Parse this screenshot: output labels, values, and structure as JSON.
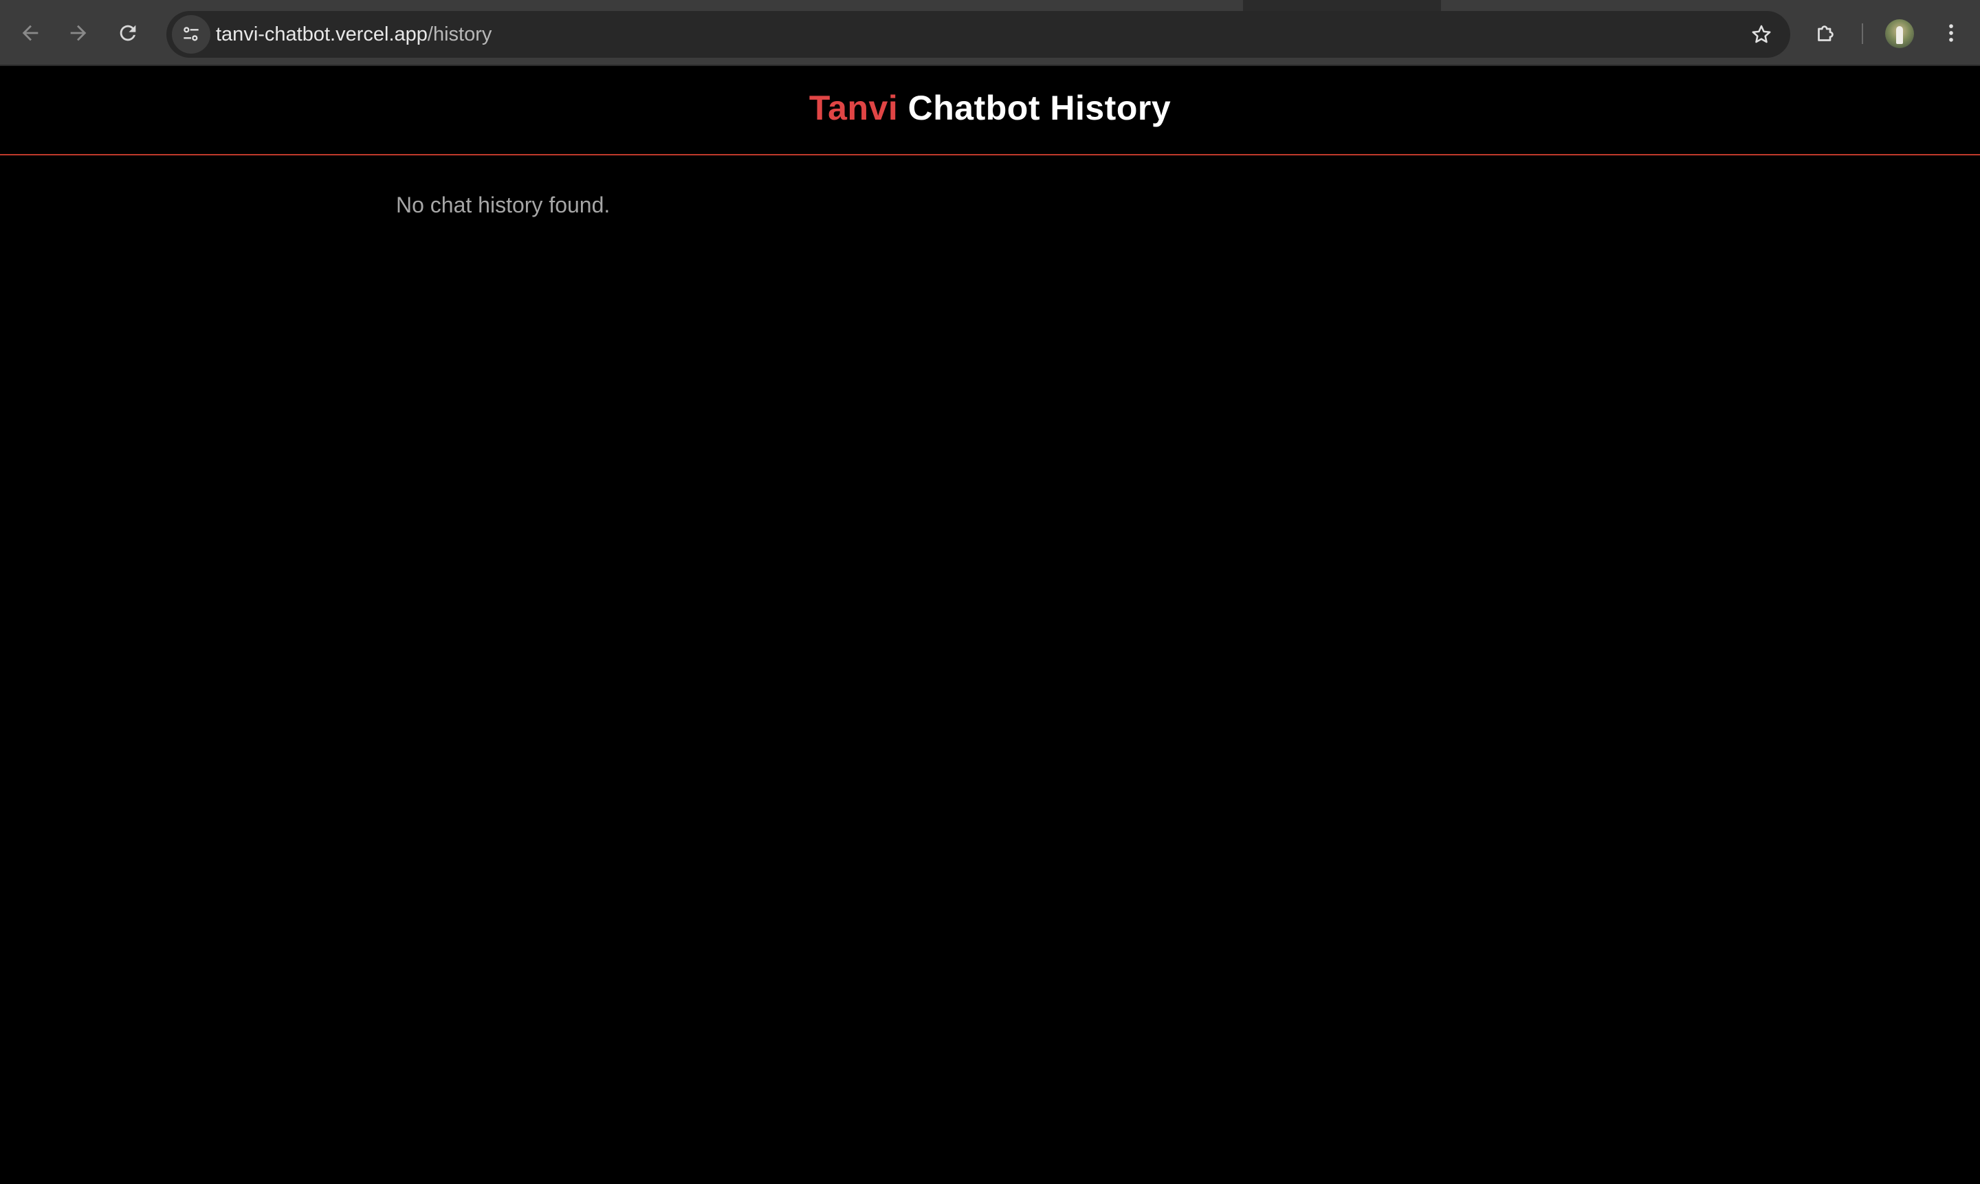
{
  "browser": {
    "url_host": "tanvi-chatbot.vercel.app",
    "url_path": "/history",
    "icons": {
      "back": "arrow-left-icon",
      "forward": "arrow-right-icon",
      "reload": "reload-icon",
      "site_info": "tune-icon",
      "bookmark": "star-icon",
      "extensions": "puzzle-icon",
      "profile": "avatar",
      "menu": "kebab-menu-icon"
    }
  },
  "header": {
    "brand": "Tanvi",
    "title_rest": " Chatbot History",
    "brand_color": "#e04545",
    "divider_color": "#c0392b"
  },
  "main": {
    "empty_message": "No chat history found."
  }
}
